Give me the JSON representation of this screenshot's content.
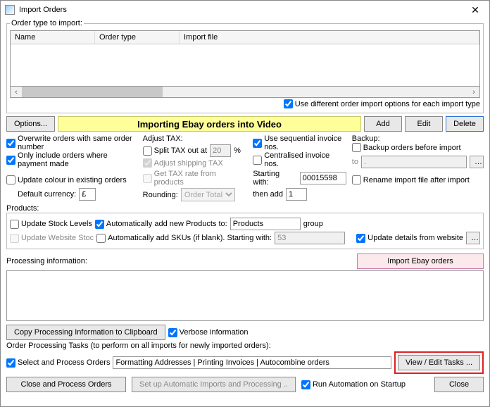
{
  "window": {
    "title": "Import Orders",
    "close": "✕"
  },
  "grid": {
    "legend": "Order type to import:",
    "h1": "Name",
    "h2": "Order type",
    "h3": "Import file"
  },
  "optRow": {
    "diffOptions": "Use different order import options for each import type",
    "options": "Options...",
    "status": "Importing Ebay orders into Video",
    "add": "Add",
    "edit": "Edit",
    "delete": "Delete"
  },
  "left": {
    "overwrite": "Overwrite orders with same order number",
    "onlyPaid": "Only include orders where payment made",
    "updateColour": "Update colour in existing orders",
    "defCurLbl": "Default currency:",
    "defCurVal": "£"
  },
  "tax": {
    "legend": "Adjust TAX:",
    "split": "Split TAX out at",
    "splitVal": "20",
    "pct": "%",
    "adjShip": "Adjust shipping TAX",
    "getRate": "Get TAX rate from products",
    "rounding": "Rounding:",
    "roundingVal": "Order Total"
  },
  "inv": {
    "useSeq": "Use sequential invoice nos.",
    "central": "Centralised invoice nos.",
    "startLbl": "Starting with:",
    "startVal": "00015598",
    "addLbl": "then add",
    "addVal": "1"
  },
  "backup": {
    "legend": "Backup:",
    "before": "Backup orders before import",
    "toLbl": "to",
    "toVal": ".",
    "rename": "Rename import file after import"
  },
  "prod": {
    "legend": "Products:",
    "updStock": "Update Stock Levels",
    "autoAdd": "Automatically add new Products to:",
    "groupVal": "Products",
    "groupLbl": "group",
    "updWeb": "Update Website Stoc",
    "autoSku": "Automatically add SKUs (if blank). Starting with:",
    "skuVal": "53",
    "updDetails": "Update details from website"
  },
  "proc": {
    "legend": "Processing information:",
    "importBtn": "Import Ebay orders",
    "copyBtn": "Copy Processing Information to Clipboard",
    "verbose": "Verbose information"
  },
  "tasks": {
    "legend": "Order Processing Tasks (to perform on all imports for newly imported orders):",
    "select": "Select and Process Orders",
    "val": "Formatting Addresses | Printing Invoices | Autocombine orders",
    "view": "View / Edit Tasks ..."
  },
  "footer": {
    "closeProc": "Close and Process Orders",
    "setup": "Set up Automatic Imports and Processing ..",
    "runAuto": "Run Automation on Startup",
    "close": "Close"
  }
}
